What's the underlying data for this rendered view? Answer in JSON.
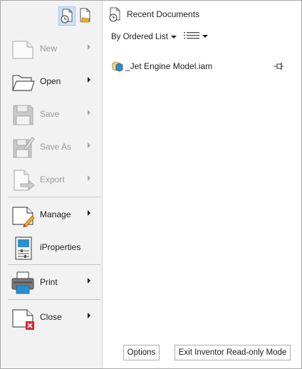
{
  "sidebar": {
    "top_icons": [
      {
        "icon": "recent-documents-icon",
        "active": true
      },
      {
        "icon": "open-documents-icon",
        "active": false
      }
    ],
    "items": [
      {
        "label": "New",
        "icon": "new-document-icon",
        "enabled": false,
        "has_submenu": true
      },
      {
        "label": "Open",
        "icon": "open-folder-icon",
        "enabled": true,
        "has_submenu": true
      },
      {
        "label": "Save",
        "icon": "floppy-disk-icon",
        "enabled": false,
        "has_submenu": true
      },
      {
        "label": "Save As",
        "icon": "save-as-icon",
        "enabled": false,
        "has_submenu": true
      },
      {
        "label": "Export",
        "icon": "export-icon",
        "enabled": false,
        "has_submenu": true
      },
      {
        "label": "Manage",
        "icon": "manage-icon",
        "enabled": true,
        "has_submenu": true
      },
      {
        "label": "iProperties",
        "icon": "iproperties-icon",
        "enabled": true,
        "has_submenu": false
      },
      {
        "label": "Print",
        "icon": "printer-icon",
        "enabled": true,
        "has_submenu": true
      },
      {
        "label": "Close",
        "icon": "close-document-icon",
        "enabled": true,
        "has_submenu": true
      }
    ]
  },
  "main": {
    "header": {
      "title": "Recent Documents",
      "icon": "recent-documents-icon"
    },
    "sort_dropdown": {
      "selected": "By Ordered List"
    },
    "view_dropdown": {
      "icon": "list-view-icon"
    },
    "documents": [
      {
        "name": "_Jet Engine Model.iam",
        "icon": "assembly-file-icon",
        "pin_icon": "pin-icon"
      }
    ],
    "buttons": {
      "options": "Options",
      "exit": "Exit Inventor Read-only Mode"
    }
  },
  "colors": {
    "sidebar_bg": "#f2f2f2",
    "selected_icon_bg": "#cde4f7",
    "accent_blue": "#1f8fd6",
    "disabled_text": "#9a9a9a",
    "close_red": "#d9262c"
  }
}
